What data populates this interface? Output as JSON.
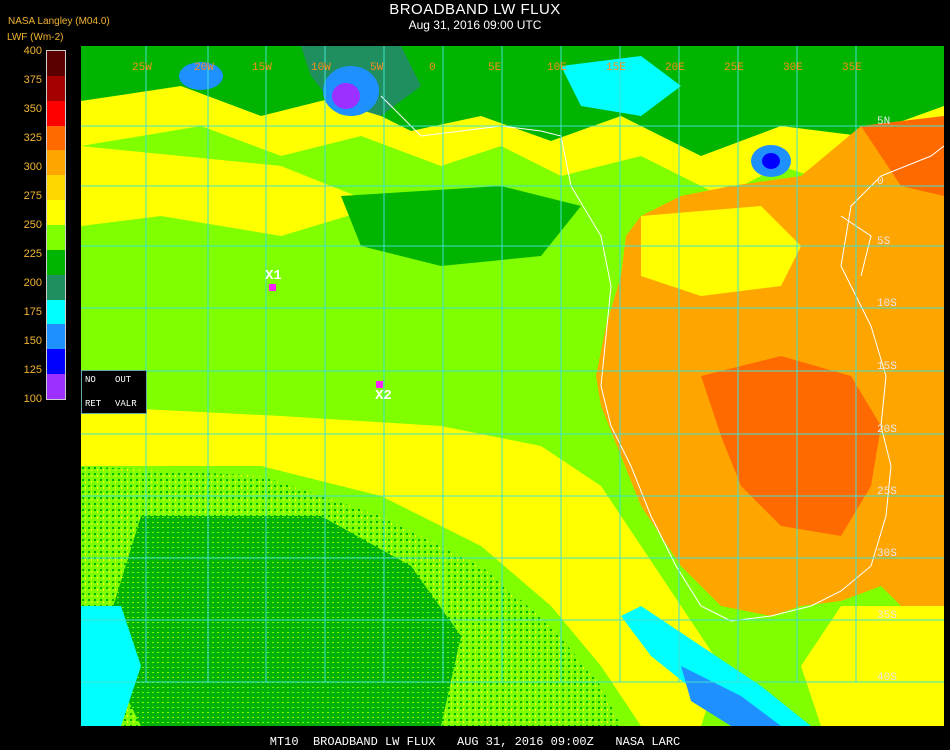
{
  "header": {
    "title": "BROADBAND LW FLUX",
    "subtitle": "Aug 31, 2016 09:00 UTC",
    "source": "NASA Langley (M04.0)",
    "unit": "LWF (Wm-2)"
  },
  "legend": {
    "ticks": [
      "400",
      "375",
      "350",
      "325",
      "300",
      "275",
      "250",
      "225",
      "200",
      "175",
      "150",
      "125",
      "100"
    ],
    "colors": [
      "#5a0000",
      "#a50000",
      "#ff0000",
      "#ff6a00",
      "#ffa500",
      "#ffd700",
      "#ffff00",
      "#7fff00",
      "#00b400",
      "#1f8f5f",
      "#00ffff",
      "#1e90ff",
      "#0000ff",
      "#9b30ff"
    ]
  },
  "map": {
    "lon_labels": [
      "25W",
      "20W",
      "15W",
      "10W",
      "5W",
      "0",
      "5E",
      "10E",
      "15E",
      "20E",
      "25E",
      "30E",
      "35E"
    ],
    "lat_labels": [
      "5N",
      "0",
      "5S",
      "10S",
      "15S",
      "20S",
      "25S",
      "30S",
      "35S",
      "40S"
    ],
    "grid_color": "#40e0d0"
  },
  "no_retrieval": {
    "no": "NO",
    "out": "OUT",
    "ret": "RET",
    "valr": "VALR"
  },
  "markers": {
    "x1": "X1",
    "x2": "X2"
  },
  "footer": "MT10  BROADBAND LW FLUX   AUG 31, 2016 09:00Z   NASA LARC"
}
